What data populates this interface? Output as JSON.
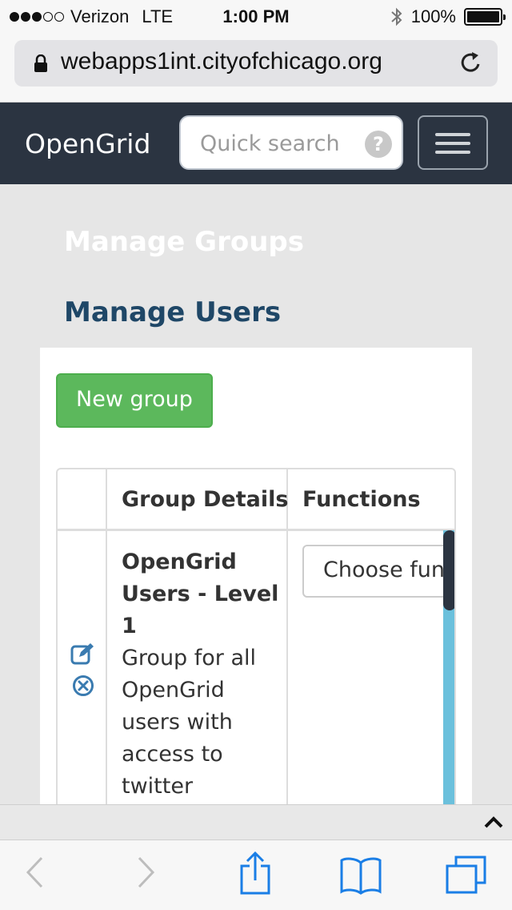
{
  "status_bar": {
    "carrier": "Verizon",
    "network": "LTE",
    "time": "1:00 PM",
    "battery": "100%",
    "signal_bars_filled": 3,
    "signal_bars_total": 5
  },
  "browser": {
    "url": "webapps1int.cityofchicago.org"
  },
  "navbar": {
    "brand": "OpenGrid",
    "search_placeholder": "Quick search",
    "help_symbol": "?"
  },
  "page": {
    "heading_groups": "Manage Groups",
    "heading_users": "Manage Users",
    "new_group_button": "New group",
    "table": {
      "headers": [
        "",
        "Group Details",
        "Functions"
      ],
      "rows": [
        {
          "name": "OpenGrid Users - Level 1",
          "description": "Group for all OpenGrid users with access to twitter",
          "functions_select": "Choose fun"
        }
      ]
    }
  },
  "colors": {
    "navbar": "#2b3441",
    "heading_users": "#1f4767",
    "button_green": "#5cb85c",
    "icon_blue": "#3a7bb0",
    "scroll_track": "#6bc0dc"
  }
}
